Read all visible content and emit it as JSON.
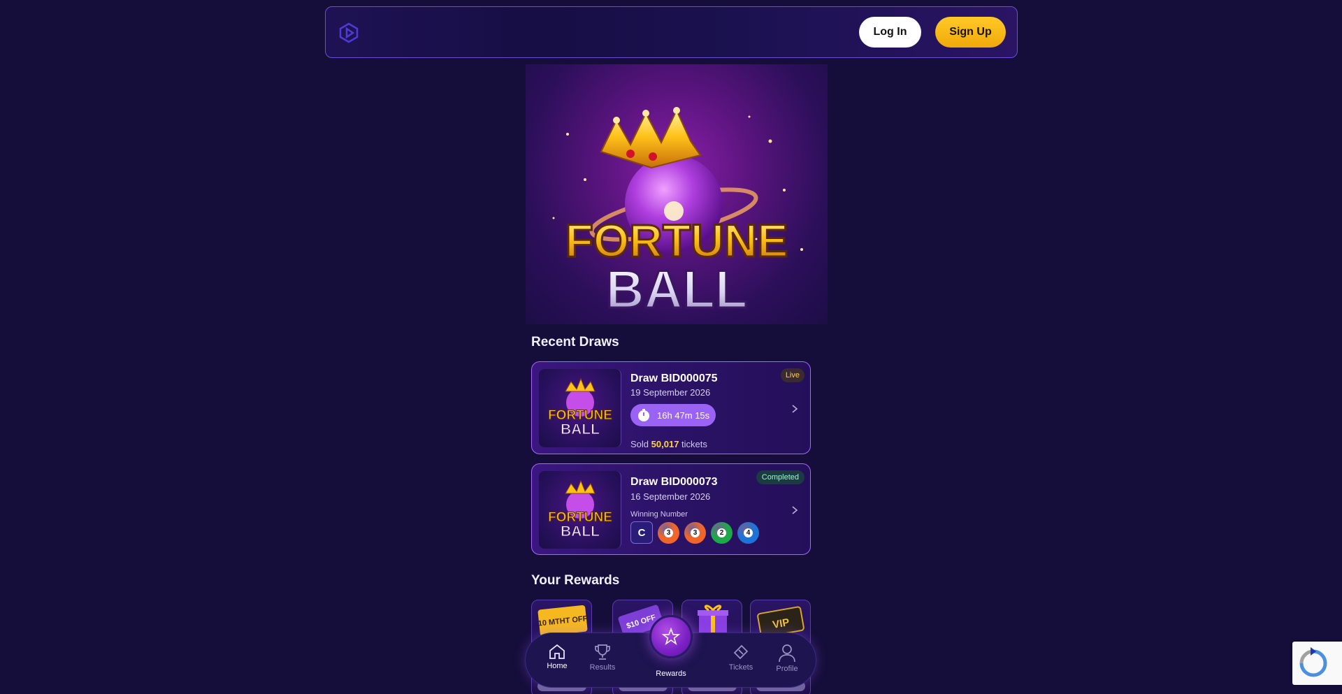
{
  "header": {
    "login_label": "Log In",
    "signup_label": "Sign Up"
  },
  "hero": {
    "logo_line1": "FORTUNE",
    "logo_line2": "BALL"
  },
  "recent_draws": {
    "title": "Recent Draws",
    "items": [
      {
        "title": "Draw BID000075",
        "date": "19 September 2026",
        "status": "Live",
        "countdown": "16h 47m 15s",
        "sold_prefix": "Sold",
        "sold_count": "50,017",
        "sold_suffix": "tickets",
        "thumb_line1": "FORTUNE",
        "thumb_line2": "BALL"
      },
      {
        "title": "Draw BID000073",
        "date": "16 September 2026",
        "status": "Completed",
        "winning_label": "Winning Number",
        "winning_letter": "C",
        "winning_balls": [
          {
            "number": "3",
            "color": "#f0662a"
          },
          {
            "number": "3",
            "color": "#f0662a"
          },
          {
            "number": "2",
            "color": "#1fa84a"
          },
          {
            "number": "4",
            "color": "#1e73d6"
          }
        ],
        "thumb_line1": "FORTUNE",
        "thumb_line2": "BALL"
      }
    ]
  },
  "rewards": {
    "title": "Your Rewards",
    "items": [
      {
        "icon": "ticket-coupon-icon",
        "text": "10 MTHT OFF"
      },
      {
        "icon": "voucher-icon",
        "text": "$10 OFF"
      },
      {
        "icon": "gift-box-icon",
        "text": ""
      },
      {
        "icon": "vip-card-icon",
        "text": "VIP"
      }
    ]
  },
  "bottom_nav": {
    "items": [
      {
        "label": "Home",
        "icon": "home-icon",
        "active": true
      },
      {
        "label": "Results",
        "icon": "trophy-icon",
        "active": false
      },
      {
        "label": "Rewards",
        "icon": "star-icon",
        "active": false
      },
      {
        "label": "Tickets",
        "icon": "ticket-icon",
        "active": false
      },
      {
        "label": "Profile",
        "icon": "user-icon",
        "active": false
      }
    ]
  },
  "colors": {
    "background": "#150e3a",
    "accent_purple": "#9b63f5",
    "signup_yellow": "#f0a90a",
    "sold_highlight": "#ffd43b"
  }
}
